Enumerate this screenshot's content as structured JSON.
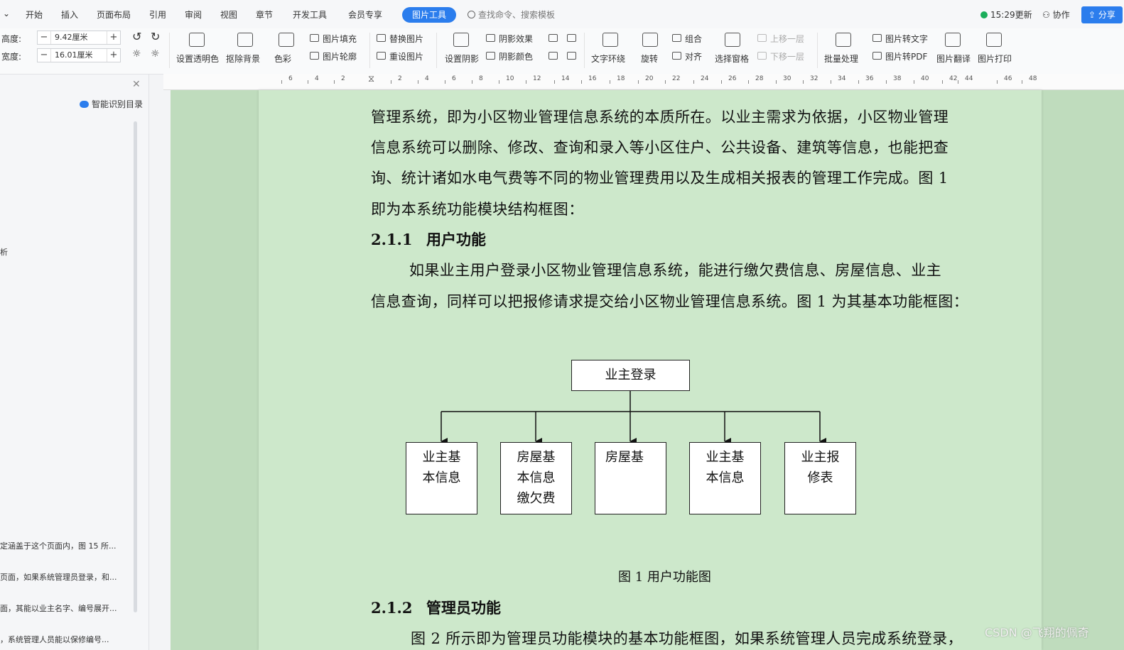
{
  "menubar": {
    "tabs": [
      "开始",
      "插入",
      "页面布局",
      "引用",
      "审阅",
      "视图",
      "章节",
      "开发工具",
      "会员专享"
    ],
    "active_tab": "图片工具",
    "search_placeholder": "查找命令、搜索模板",
    "update_label": "15:29更新",
    "collab_label": "协作",
    "share_label": "分享"
  },
  "ribbon": {
    "height_label": "高度:",
    "height_value": "9.42厘米",
    "width_label": "宽度:",
    "width_value": "16.01厘米",
    "set_transparent": "设置透明色",
    "remove_bg": "抠除背景",
    "color": "色彩",
    "fill": "图片填充",
    "outline": "图片轮廓",
    "replace": "替换图片",
    "reset": "重设图片",
    "set_shadow": "设置阴影",
    "shadow_effect": "阴影效果",
    "shadow_color": "阴影颜色",
    "text_wrap": "文字环绕",
    "rotate": "旋转",
    "group": "组合",
    "align": "对齐",
    "select_pane": "选择窗格",
    "bring_forward": "上移一层",
    "send_backward": "下移一层",
    "batch": "批量处理",
    "to_text": "图片转文字",
    "to_pdf": "图片转PDF",
    "translate": "图片翻译",
    "print": "图片打印"
  },
  "nav": {
    "smart_toc": "智能识别目录",
    "items": [
      {
        "text": "析"
      },
      {
        "text": "定涵盖于这个页面内，图 15 所..."
      },
      {
        "text": "页面，如果系统管理员登录，和..."
      },
      {
        "text": "面，其能以业主名字、编号展开..."
      },
      {
        "text": "，系统管理人员能以保修编号..."
      }
    ]
  },
  "ruler": {
    "ticks": [
      "6",
      "4",
      "2",
      "2",
      "4",
      "6",
      "8",
      "10",
      "12",
      "14",
      "16",
      "18",
      "20",
      "22",
      "24",
      "26",
      "28",
      "30",
      "32",
      "34",
      "36",
      "38",
      "40",
      "42",
      "44",
      "46",
      "48"
    ]
  },
  "document": {
    "lines": [
      "管理系统，即为小区物业管理信息系统的本质所在。以业主需求为依据，小区物业管理",
      "信息系统可以删除、修改、查询和录入等小区住户、公共设备、建筑等信息，也能把查",
      "询、统计诸如水电气费等不同的物业管理费用以及生成相关报表的管理工作完成。图 1",
      "即为本系统功能模块结构框图："
    ],
    "heading1_num": "2.1.1",
    "heading1_title": "用户功能",
    "para2": [
      "如果业主用户登录小区物业管理信息系统，能进行缴欠费信息、房屋信息、业主",
      "信息查询，同样可以把报修请求提交给小区物业管理信息系统。图 1 为其基本功能框图："
    ],
    "diagram": {
      "root": "业主登录",
      "children": [
        [
          "业主基",
          "本信息"
        ],
        [
          "房屋基",
          "本信息",
          "缴欠费"
        ],
        [
          "房屋基"
        ],
        [
          "业主基",
          "本信息"
        ],
        [
          "业主报",
          "修表"
        ]
      ]
    },
    "caption": "图 1 用户功能图",
    "heading2_num": "2.1.2",
    "heading2_title": "管理员功能",
    "last_line": "图 2 所示即为管理员功能模块的基本功能框图，如果系统管理人员完成系统登录，"
  },
  "watermark": "CSDN @飞翔的佩奇",
  "colors": {
    "accent": "#2b7ded",
    "page_bg": "#cde8cb",
    "doc_bg": "#bfdcbd"
  }
}
